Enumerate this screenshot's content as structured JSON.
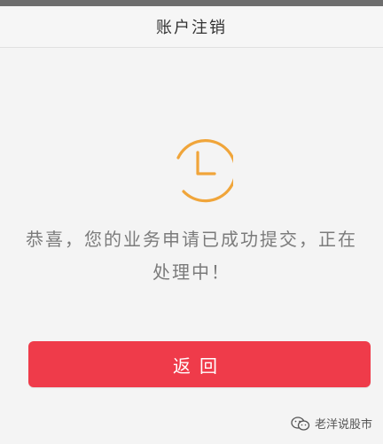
{
  "header": {
    "title": "账户注销"
  },
  "status": {
    "icon": "clock-icon",
    "icon_color": "#f0a53a",
    "message": "恭喜，您的业务申请已成功提交，正在处理中！"
  },
  "actions": {
    "back_label": "返回",
    "back_color": "#ef3b4a"
  },
  "watermark": {
    "icon": "wechat-icon",
    "text": "老洋说股市"
  }
}
